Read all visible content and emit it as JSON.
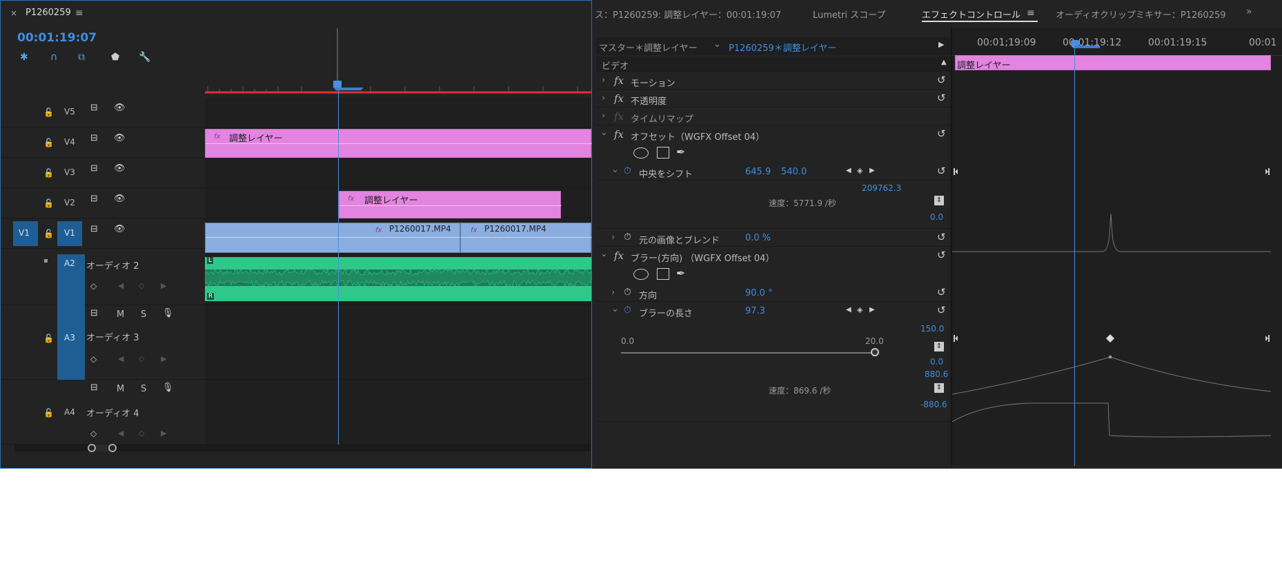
{
  "sequence": {
    "title": "P1260259",
    "timecode": "00:01:19:07"
  },
  "tracks": {
    "v5": "V5",
    "v4": "V4",
    "v3": "V3",
    "v2": "V2",
    "v1": "V1",
    "v1_src": "V1",
    "a2": "A2",
    "a2_name": "オーディオ 2",
    "a3": "A3",
    "a3_name": "オーディオ 3",
    "a4": "A4",
    "a4_name": "オーディオ 4",
    "m": "M",
    "s": "S",
    "ch_l": "L",
    "ch_r": "R"
  },
  "clips": {
    "v4_clip": "調整レイヤー",
    "v2_clip": "調整レイヤー",
    "v1_clip1": "P1260017.MP4",
    "v1_clip2": "P1260017.MP4",
    "fx": "fx"
  },
  "tabs": [
    {
      "label": "ス：P1260259: 調整レイヤー：00:01:19:07"
    },
    {
      "label": "Lumetri スコープ"
    },
    {
      "label": "エフェクトコントロール"
    },
    {
      "label": "オーディオクリップミキサー：P1260259"
    }
  ],
  "effect_controls": {
    "master_label": "マスター＊調整レイヤー",
    "clip_label": "P1260259＊調整レイヤー",
    "section_video": "ビデオ",
    "effects": {
      "motion": "モーション",
      "opacity": "不透明度",
      "time_remap": "タイムリマップ",
      "offset": "オフセット（WGFX Offset 04）",
      "shift_center": "中央をシフト",
      "shift_x": "645.9",
      "shift_y": "540.0",
      "graph_max1": "209762.3",
      "speed1": "速度：5771.9 /秒",
      "graph_min1": "0.0",
      "blend": "元の画像とブレンド",
      "blend_val": "0.0 %",
      "blur": "ブラー(方向) （WGFX Offset 04）",
      "direction": "方向",
      "direction_val": "90.0 °",
      "blur_len": "ブラーの長さ",
      "blur_len_val": "97.3",
      "slider_min": "0.0",
      "slider_max": "20.0",
      "graph_max2": "150.0",
      "graph_min2": "0.0",
      "vel_max": "880.6",
      "speed2": "速度：869.6 /秒",
      "vel_min": "-880.6"
    }
  },
  "ruler": {
    "t1": "00:01;19:09",
    "t2": "00:01:19:12",
    "t3": "00:01:19:15",
    "t4": "00:01"
  },
  "ec_clip": "調整レイヤー",
  "colors": {
    "accent": "#3d8fe0",
    "pink": "#e384e0",
    "audio": "#2ec98a",
    "blue_clip": "#8aaee0",
    "playhead": "#4a8fe0",
    "in_out": "#e03030"
  }
}
